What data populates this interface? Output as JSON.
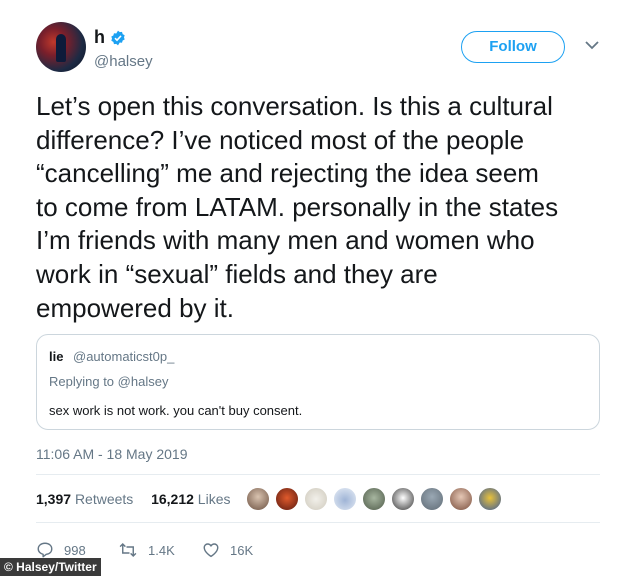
{
  "author": {
    "name": "h",
    "handle": "@halsey"
  },
  "follow_label": "Follow",
  "tweet_lines": [
    "Let’s open this conversation. Is this a cultural",
    "difference? I’ve noticed most of the people",
    "“cancelling” me and rejecting the idea seem",
    "to come from LATAM. personally in the states",
    "I’m friends with many men and women who",
    "work in “sexual” fields and they are",
    "empowered by it."
  ],
  "quoted": {
    "name": "lie",
    "handle": "@automaticst0p_",
    "replying_prefix": "Replying to",
    "replying_handle": "@halsey",
    "text": "sex work is not work. you can't buy consent."
  },
  "timestamp": "11:06 AM - 18 May 2019",
  "stats": {
    "retweets_count": "1,397",
    "retweets_label": "Retweets",
    "likes_count": "16,212",
    "likes_label": "Likes"
  },
  "actions": {
    "replies": "998",
    "retweets": "1.4K",
    "likes": "16K"
  },
  "watermark": "© Halsey/Twitter",
  "colors": {
    "accent": "#1da1f2",
    "muted": "#657786",
    "border": "#ccd6dd"
  }
}
